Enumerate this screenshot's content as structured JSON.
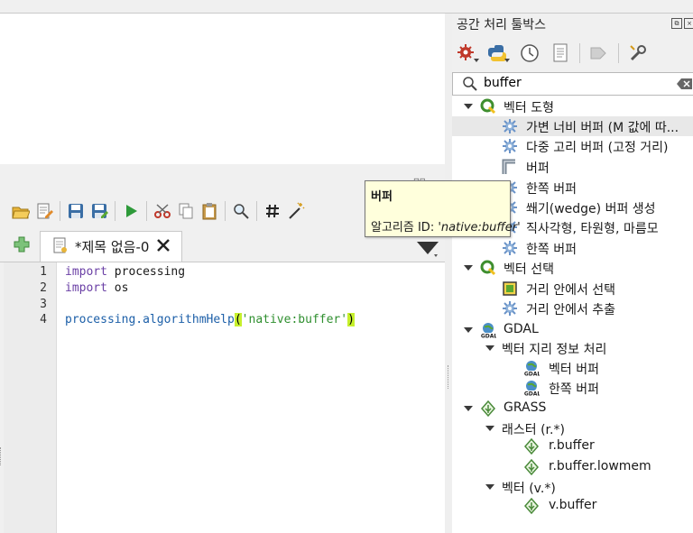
{
  "editor": {
    "tab_title": "*제목 없음-0",
    "lines": [
      {
        "num": "1",
        "kw": "import",
        "rest": " processing"
      },
      {
        "num": "2",
        "kw": "import",
        "rest": " os"
      },
      {
        "num": "3"
      },
      {
        "num": "4",
        "prefix": "processing.algorithmHelp",
        "open": "(",
        "arg": "'native:buffer'",
        "close": ")"
      }
    ]
  },
  "toolbox": {
    "title": "공간 처리 툴박스",
    "search_value": "buffer",
    "tree": [
      {
        "label": "벡터 도형",
        "icon": "qgis-icon",
        "expanded": true
      },
      {
        "label": "가변 너비 버퍼 (M 값에 따...",
        "icon": "gear-icon",
        "selected": true
      },
      {
        "label": "다중 고리 버퍼 (고정 거리)",
        "icon": "gear-icon"
      },
      {
        "label": "버퍼",
        "icon": "buffer-icon"
      },
      {
        "label": "한쪽 버퍼",
        "icon": "gear-icon"
      },
      {
        "label": "쐐기(wedge) 버퍼 생성",
        "icon": "gear-icon"
      },
      {
        "label": "직사각형, 타원형, 마름모",
        "icon": "gear-icon"
      },
      {
        "label": "한쪽 버퍼",
        "icon": "gear-icon"
      },
      {
        "label": "벡터 선택",
        "icon": "qgis-icon",
        "expanded": true
      },
      {
        "label": "거리 안에서 선택",
        "icon": "select-icon"
      },
      {
        "label": "거리 안에서 추출",
        "icon": "gear-icon"
      },
      {
        "label": "GDAL",
        "icon": "gdal-icon",
        "expanded": true
      },
      {
        "label": "벡터 지리 정보 처리",
        "expanded": true
      },
      {
        "label": "벡터 버퍼",
        "icon": "gdal-icon"
      },
      {
        "label": "한쪽 버퍼",
        "icon": "gdal-icon"
      },
      {
        "label": "GRASS",
        "icon": "grass-icon",
        "expanded": true
      },
      {
        "label": "래스터 (r.*)",
        "expanded": true
      },
      {
        "label": "r.buffer",
        "icon": "grass-icon"
      },
      {
        "label": "r.buffer.lowmem",
        "icon": "grass-icon"
      },
      {
        "label": "벡터 (v.*)",
        "expanded": true
      },
      {
        "label": "v.buffer",
        "icon": "grass-icon"
      }
    ]
  },
  "tooltip": {
    "title": "버퍼",
    "id_label": "알고리즘 ID: ",
    "id_value": "'native:buffer'"
  },
  "colors": {
    "accent": "#6a3fa5",
    "string": "#2f8f2f",
    "bracket_highlight": "#c6f02c",
    "tooltip_bg": "#ffffdc"
  }
}
